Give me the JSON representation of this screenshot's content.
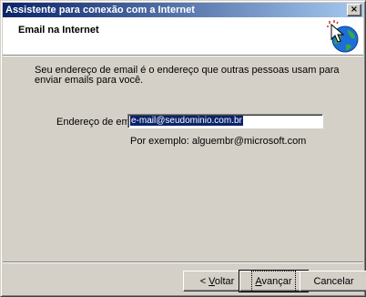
{
  "window": {
    "title": "Assistente para conexão com a Internet",
    "close_glyph": "×"
  },
  "header": {
    "title": "Email na Internet",
    "icon": "wizard-globe-cursor-icon"
  },
  "body": {
    "description": "Seu endereço de email é o endereço que outras pessoas usam para enviar emails para você.",
    "email_label": "Endereço de email:",
    "email_value": "e-mail@seudominio.com.br",
    "example": "Por exemplo: alguembr@microsoft.com"
  },
  "buttons": {
    "back_prefix": "< ",
    "back_accel": "V",
    "back_rest": "oltar",
    "next_accel": "A",
    "next_rest": "vançar",
    "cancel": "Cancelar"
  },
  "colors": {
    "titlebar_start": "#0a246a",
    "titlebar_end": "#a6caf0",
    "face": "#d4d0c8",
    "selection": "#0a246a"
  }
}
